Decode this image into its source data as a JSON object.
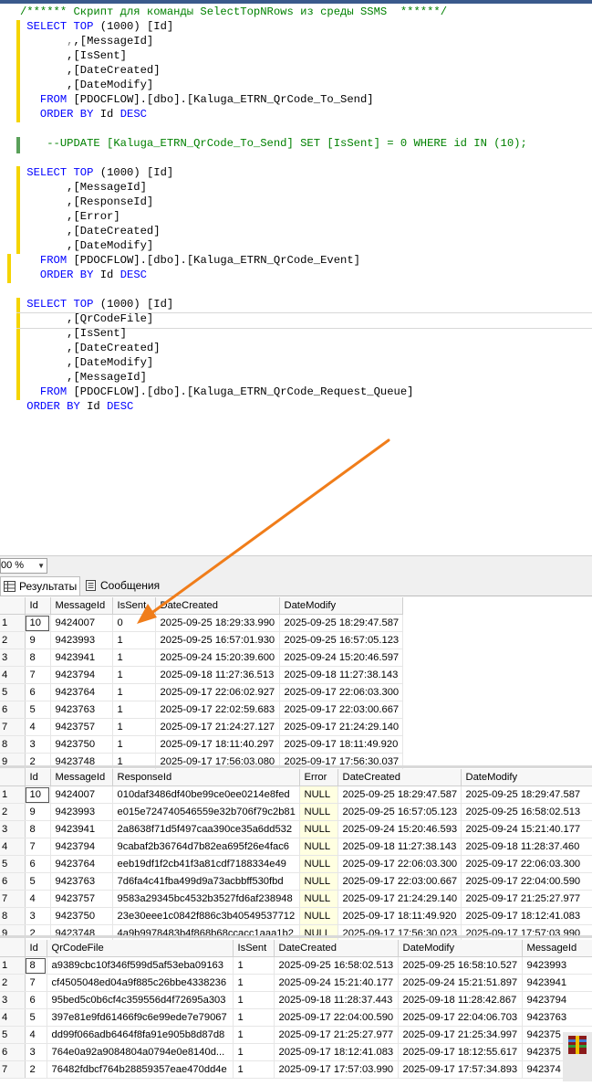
{
  "editor": {
    "header_comment": "/****** Скрипт для команды SelectTopNRows из среды SSMS  ******/",
    "query1": {
      "select": "SELECT",
      "top": "TOP",
      "top_num": "(1000)",
      "first_col": "[Id]",
      "cols": [
        ",[MessageId]",
        ",[IsSent]",
        ",[DateCreated]",
        ",[DateModify]"
      ],
      "from": "FROM",
      "table": "[PDOCFLOW].[dbo].[Kaluga_ETRN_QrCode_To_Send]",
      "order": "ORDER BY",
      "order_col": "Id",
      "desc": "DESC",
      "update_comment": "--UPDATE [Kaluga_ETRN_QrCode_To_Send] SET [IsSent] = 0 WHERE id IN (10);"
    },
    "query2": {
      "select": "SELECT",
      "top": "TOP",
      "top_num": "(1000)",
      "first_col": "[Id]",
      "cols": [
        ",[MessageId]",
        ",[ResponseId]",
        ",[Error]",
        ",[DateCreated]",
        ",[DateModify]"
      ],
      "from": "FROM",
      "table": "[PDOCFLOW].[dbo].[Kaluga_ETRN_QrCode_Event]",
      "order": "ORDER BY",
      "order_col": "Id",
      "desc": "DESC"
    },
    "query3": {
      "select": "SELECT",
      "top": "TOP",
      "top_num": "(1000)",
      "first_col": "[Id]",
      "cols": [
        ",[QrCodeFile]",
        ",[IsSent]",
        ",[DateCreated]",
        ",[DateModify]",
        ",[MessageId]"
      ],
      "from": "FROM",
      "table": "[PDOCFLOW].[dbo].[Kaluga_ETRN_QrCode_Request_Queue]",
      "order": "ORDER BY",
      "order_col": "Id",
      "desc": "DESC"
    }
  },
  "zoom": "00 %",
  "tabs": {
    "results": "Результаты",
    "messages": "Сообщения"
  },
  "grid1": {
    "headers": [
      "Id",
      "MessageId",
      "IsSent",
      "DateCreated",
      "DateModify"
    ],
    "rows": [
      [
        "1",
        "10",
        "9424007",
        "0",
        "2025-09-25 18:29:33.990",
        "2025-09-25 18:29:47.587"
      ],
      [
        "2",
        "9",
        "9423993",
        "1",
        "2025-09-25 16:57:01.930",
        "2025-09-25 16:57:05.123"
      ],
      [
        "3",
        "8",
        "9423941",
        "1",
        "2025-09-24 15:20:39.600",
        "2025-09-24 15:20:46.597"
      ],
      [
        "4",
        "7",
        "9423794",
        "1",
        "2025-09-18 11:27:36.513",
        "2025-09-18 11:27:38.143"
      ],
      [
        "5",
        "6",
        "9423764",
        "1",
        "2025-09-17 22:06:02.927",
        "2025-09-17 22:06:03.300"
      ],
      [
        "6",
        "5",
        "9423763",
        "1",
        "2025-09-17 22:02:59.683",
        "2025-09-17 22:03:00.667"
      ],
      [
        "7",
        "4",
        "9423757",
        "1",
        "2025-09-17 21:24:27.127",
        "2025-09-17 21:24:29.140"
      ],
      [
        "8",
        "3",
        "9423750",
        "1",
        "2025-09-17 18:11:40.297",
        "2025-09-17 18:11:49.920"
      ],
      [
        "9",
        "2",
        "9423748",
        "1",
        "2025-09-17 17:56:03.080",
        "2025-09-17 17:56:30.037"
      ]
    ]
  },
  "grid2": {
    "headers": [
      "Id",
      "MessageId",
      "ResponseId",
      "Error",
      "DateCreated",
      "DateModify"
    ],
    "rows": [
      [
        "1",
        "10",
        "9424007",
        "010daf3486df40be99ce0ee0214e8fed",
        "NULL",
        "2025-09-25 18:29:47.587",
        "2025-09-25 18:29:47.587"
      ],
      [
        "2",
        "9",
        "9423993",
        "e015e724740546559e32b706f79c2b81",
        "NULL",
        "2025-09-25 16:57:05.123",
        "2025-09-25 16:58:02.513"
      ],
      [
        "3",
        "8",
        "9423941",
        "2a8638f71d5f497caa390ce35a6dd532",
        "NULL",
        "2025-09-24 15:20:46.593",
        "2025-09-24 15:21:40.177"
      ],
      [
        "4",
        "7",
        "9423794",
        "9cabaf2b36764d7b82ea695f26e4fac6",
        "NULL",
        "2025-09-18 11:27:38.143",
        "2025-09-18 11:28:37.460"
      ],
      [
        "5",
        "6",
        "9423764",
        "eeb19df1f2cb41f3a81cdf7188334e49",
        "NULL",
        "2025-09-17 22:06:03.300",
        "2025-09-17 22:06:03.300"
      ],
      [
        "6",
        "5",
        "9423763",
        "7d6fa4c41fba499d9a73acbbff530fbd",
        "NULL",
        "2025-09-17 22:03:00.667",
        "2025-09-17 22:04:00.590"
      ],
      [
        "7",
        "4",
        "9423757",
        "9583a29345bc4532b3527fd6af238948",
        "NULL",
        "2025-09-17 21:24:29.140",
        "2025-09-17 21:25:27.977"
      ],
      [
        "8",
        "3",
        "9423750",
        "23e30eee1c0842f886c3b40549537712",
        "NULL",
        "2025-09-17 18:11:49.920",
        "2025-09-17 18:12:41.083"
      ],
      [
        "9",
        "2",
        "9423748",
        "4a9b9978483b4f868b68ccacc1aaa1b2",
        "NULL",
        "2025-09-17 17:56:30.023",
        "2025-09-17 17:57:03.990"
      ]
    ]
  },
  "grid3": {
    "headers": [
      "Id",
      "QrCodeFile",
      "IsSent",
      "DateCreated",
      "DateModify",
      "MessageId"
    ],
    "rows": [
      [
        "1",
        "8",
        "a9389cbc10f346f599d5af53eba09163",
        "1",
        "2025-09-25 16:58:02.513",
        "2025-09-25 16:58:10.527",
        "9423993"
      ],
      [
        "2",
        "7",
        "cf4505048ed04a9f885c26bbe4338236",
        "1",
        "2025-09-24 15:21:40.177",
        "2025-09-24 15:21:51.897",
        "9423941"
      ],
      [
        "3",
        "6",
        "95bed5c0b6cf4c359556d4f72695a303",
        "1",
        "2025-09-18 11:28:37.443",
        "2025-09-18 11:28:42.867",
        "9423794"
      ],
      [
        "4",
        "5",
        "397e81e9fd61466f9c6e99ede7e79067",
        "1",
        "2025-09-17 22:04:00.590",
        "2025-09-17 22:04:06.703",
        "9423763"
      ],
      [
        "5",
        "4",
        "dd99f066adb6464f8fa91e905b8d87d8",
        "1",
        "2025-09-17 21:25:27.977",
        "2025-09-17 21:25:34.997",
        "942375"
      ],
      [
        "6",
        "3",
        "764e0a92a9084804a0794e0e8140d...",
        "1",
        "2025-09-17 18:12:41.083",
        "2025-09-17 18:12:55.617",
        "942375"
      ],
      [
        "7",
        "2",
        "76482fdbcf764b28859357eae470dd4e",
        "1",
        "2025-09-17 17:57:03.990",
        "2025-09-17 17:57:34.893",
        "942374"
      ]
    ]
  }
}
